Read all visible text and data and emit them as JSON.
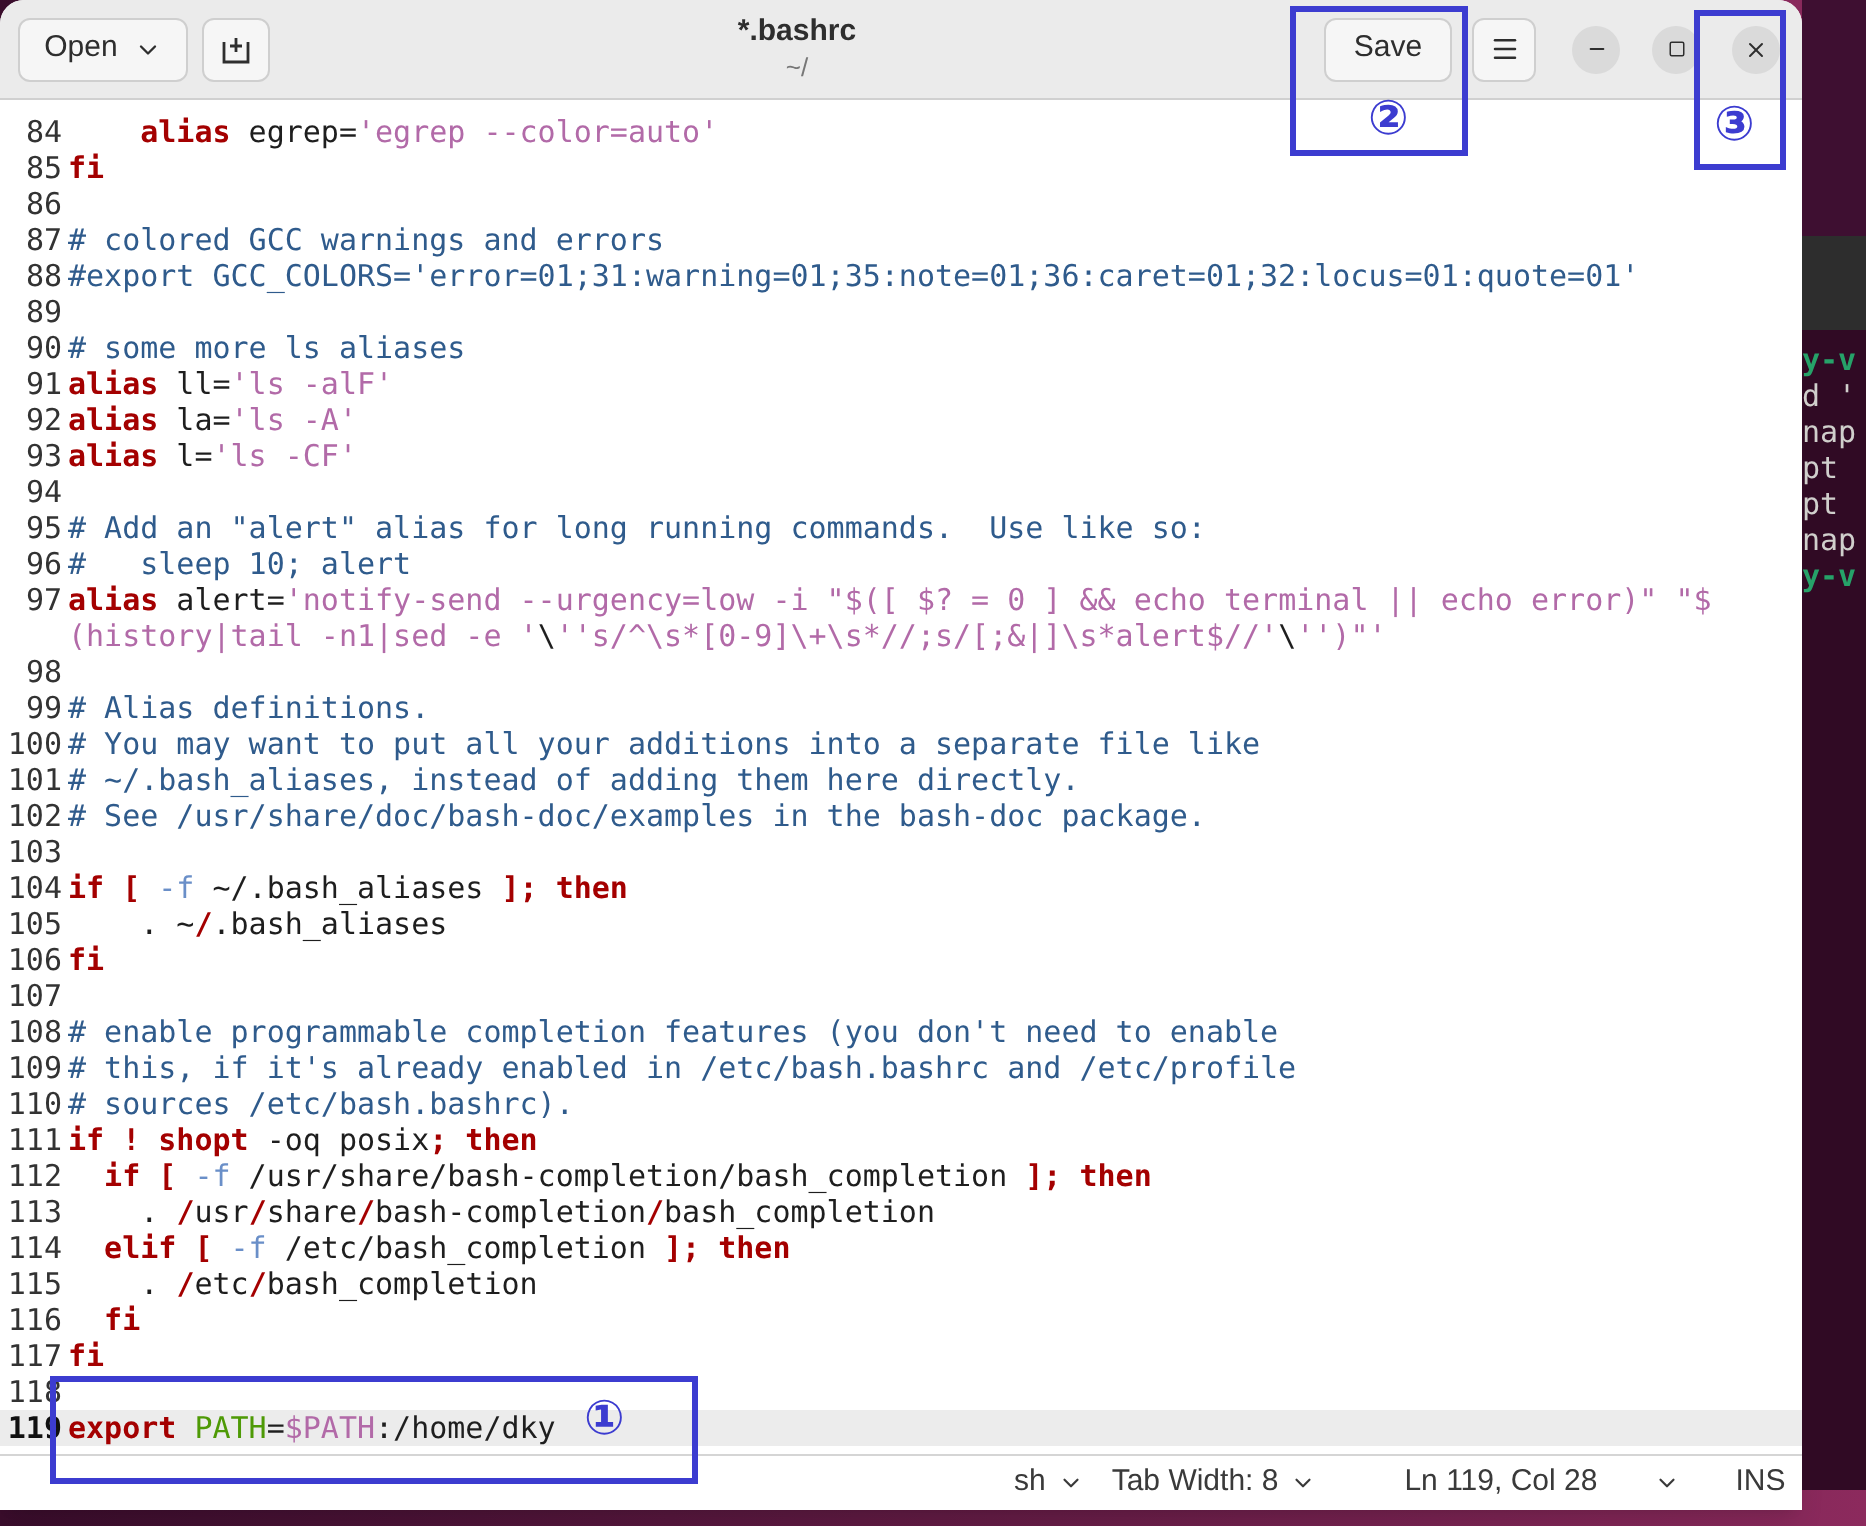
{
  "window": {
    "title": "*.bashrc",
    "subtitle": "~/"
  },
  "header": {
    "open_label": "Open",
    "save_label": "Save"
  },
  "editor": {
    "lines": [
      {
        "number": "84",
        "current": false,
        "tokens": [
          {
            "kind": "keyword",
            "text": "    alias"
          },
          {
            "kind": "plain",
            "text": " egrep="
          },
          {
            "kind": "string",
            "text": "'egrep --color=auto'"
          }
        ]
      },
      {
        "number": "85",
        "current": false,
        "tokens": [
          {
            "kind": "keyword",
            "text": "fi"
          }
        ]
      },
      {
        "number": "86",
        "current": false
      },
      {
        "number": "87",
        "current": false,
        "tokens": [
          {
            "kind": "comment",
            "text": "# colored GCC warnings and errors"
          }
        ]
      },
      {
        "number": "88",
        "current": false,
        "tokens": [
          {
            "kind": "comment",
            "text": "#export GCC_COLORS='error=01;31:warning=01;35:note=01;36:caret=01;32:locus=01:quote=01'"
          }
        ]
      },
      {
        "number": "89",
        "current": false
      },
      {
        "number": "90",
        "current": false,
        "tokens": [
          {
            "kind": "comment",
            "text": "# some more ls aliases"
          }
        ]
      },
      {
        "number": "91",
        "current": false,
        "tokens": [
          {
            "kind": "keyword",
            "text": "alias"
          },
          {
            "kind": "plain",
            "text": " ll="
          },
          {
            "kind": "string",
            "text": "'ls -alF'"
          }
        ]
      },
      {
        "number": "92",
        "current": false,
        "tokens": [
          {
            "kind": "keyword",
            "text": "alias"
          },
          {
            "kind": "plain",
            "text": " la="
          },
          {
            "kind": "string",
            "text": "'ls -A'"
          }
        ]
      },
      {
        "number": "93",
        "current": false,
        "tokens": [
          {
            "kind": "keyword",
            "text": "alias"
          },
          {
            "kind": "plain",
            "text": " l="
          },
          {
            "kind": "string",
            "text": "'ls -CF'"
          }
        ]
      },
      {
        "number": "94",
        "current": false
      },
      {
        "number": "95",
        "current": false,
        "tokens": [
          {
            "kind": "comment",
            "text": "# Add an \"alert\" alias for long running commands.  Use like so:"
          }
        ]
      },
      {
        "number": "96",
        "current": false,
        "tokens": [
          {
            "kind": "comment",
            "text": "#   sleep 10; alert"
          }
        ]
      },
      {
        "number": "97",
        "current": false,
        "tokens": [
          {
            "kind": "keyword",
            "text": "alias"
          },
          {
            "kind": "plain",
            "text": " alert="
          },
          {
            "kind": "string",
            "text": "'notify-send --urgency=low -i \"$([ $? = 0 ] && echo terminal || echo error)\" \"$"
          }
        ],
        "continuation": [
          {
            "kind": "string",
            "text": "(history|tail -n1|sed -e '"
          },
          {
            "kind": "plain",
            "text": "\\"
          },
          {
            "kind": "string",
            "text": "''s/^\\s*[0-9]\\+\\s*//;s/[;&|]\\s*alert$//'"
          },
          {
            "kind": "plain",
            "text": "\\"
          },
          {
            "kind": "string",
            "text": "'')\"'"
          }
        ]
      },
      {
        "number": "98",
        "current": false
      },
      {
        "number": "99",
        "current": false,
        "tokens": [
          {
            "kind": "comment",
            "text": "# Alias definitions."
          }
        ]
      },
      {
        "number": "100",
        "current": false,
        "tokens": [
          {
            "kind": "comment",
            "text": "# You may want to put all your additions into a separate file like"
          }
        ]
      },
      {
        "number": "101",
        "current": false,
        "tokens": [
          {
            "kind": "comment",
            "text": "# ~/.bash_aliases, instead of adding them here directly."
          }
        ]
      },
      {
        "number": "102",
        "current": false,
        "tokens": [
          {
            "kind": "comment",
            "text": "# See /usr/share/doc/bash-doc/examples in the bash-doc package."
          }
        ]
      },
      {
        "number": "103",
        "current": false
      },
      {
        "number": "104",
        "current": false,
        "tokens": [
          {
            "kind": "keyword",
            "text": "if ["
          },
          {
            "kind": "option",
            "text": " -f"
          },
          {
            "kind": "plain",
            "text": " ~/.bash_aliases "
          },
          {
            "kind": "keyword",
            "text": "]; then"
          }
        ]
      },
      {
        "number": "105",
        "current": false,
        "tokens": [
          {
            "kind": "plain",
            "text": "    . ~"
          },
          {
            "kind": "keyword",
            "text": "/"
          },
          {
            "kind": "plain",
            "text": ".bash_aliases"
          }
        ]
      },
      {
        "number": "106",
        "current": false,
        "tokens": [
          {
            "kind": "keyword",
            "text": "fi"
          }
        ]
      },
      {
        "number": "107",
        "current": false
      },
      {
        "number": "108",
        "current": false,
        "tokens": [
          {
            "kind": "comment",
            "text": "# enable programmable completion features (you don't need to enable"
          }
        ]
      },
      {
        "number": "109",
        "current": false,
        "tokens": [
          {
            "kind": "comment",
            "text": "# this, if it's already enabled in /etc/bash.bashrc and /etc/profile"
          }
        ]
      },
      {
        "number": "110",
        "current": false,
        "tokens": [
          {
            "kind": "comment",
            "text": "# sources /etc/bash.bashrc)."
          }
        ]
      },
      {
        "number": "111",
        "current": false,
        "tokens": [
          {
            "kind": "keyword",
            "text": "if ! shopt"
          },
          {
            "kind": "plain",
            "text": " -oq posix"
          },
          {
            "kind": "keyword",
            "text": "; then"
          }
        ]
      },
      {
        "number": "112",
        "current": false,
        "tokens": [
          {
            "kind": "keyword",
            "text": "  if ["
          },
          {
            "kind": "option",
            "text": " -f"
          },
          {
            "kind": "plain",
            "text": " /usr/share/bash-completion/bash_completion "
          },
          {
            "kind": "keyword",
            "text": "]; then"
          }
        ]
      },
      {
        "number": "113",
        "current": false,
        "tokens": [
          {
            "kind": "plain",
            "text": "    . "
          },
          {
            "kind": "keyword",
            "text": "/"
          },
          {
            "kind": "plain",
            "text": "usr"
          },
          {
            "kind": "keyword",
            "text": "/"
          },
          {
            "kind": "plain",
            "text": "share"
          },
          {
            "kind": "keyword",
            "text": "/"
          },
          {
            "kind": "plain",
            "text": "bash-completion"
          },
          {
            "kind": "keyword",
            "text": "/"
          },
          {
            "kind": "plain",
            "text": "bash_completion"
          }
        ]
      },
      {
        "number": "114",
        "current": false,
        "tokens": [
          {
            "kind": "keyword",
            "text": "  elif ["
          },
          {
            "kind": "option",
            "text": " -f"
          },
          {
            "kind": "plain",
            "text": " /etc/bash_completion "
          },
          {
            "kind": "keyword",
            "text": "]; then"
          }
        ]
      },
      {
        "number": "115",
        "current": false,
        "tokens": [
          {
            "kind": "plain",
            "text": "    . "
          },
          {
            "kind": "keyword",
            "text": "/"
          },
          {
            "kind": "plain",
            "text": "etc"
          },
          {
            "kind": "keyword",
            "text": "/"
          },
          {
            "kind": "plain",
            "text": "bash_completion"
          }
        ]
      },
      {
        "number": "116",
        "current": false,
        "tokens": [
          {
            "kind": "keyword",
            "text": "  fi"
          }
        ]
      },
      {
        "number": "117",
        "current": false,
        "tokens": [
          {
            "kind": "keyword",
            "text": "fi"
          }
        ]
      },
      {
        "number": "118",
        "current": false
      },
      {
        "number": "119",
        "current": true,
        "tokens": [
          {
            "kind": "keyword",
            "text": "export"
          },
          {
            "kind": "variable",
            "text": " PATH"
          },
          {
            "kind": "plain",
            "text": "="
          },
          {
            "kind": "string",
            "text": "$PATH"
          },
          {
            "kind": "plain",
            "text": ":/home/dky"
          }
        ]
      }
    ]
  },
  "status_bar": {
    "language": "sh",
    "tab_width": "Tab Width: 8",
    "position": "Ln 119, Col 28",
    "mode": "INS"
  },
  "annotations": [
    {
      "kind": "save",
      "label": "②"
    },
    {
      "kind": "close",
      "label": "③"
    },
    {
      "kind": "last_line",
      "label": "①"
    }
  ],
  "background_terminal": {
    "lines": [
      {
        "kind": "prompt",
        "text": "y-v"
      },
      {
        "kind": "output",
        "text": "d '"
      },
      {
        "kind": "output",
        "text": "nap"
      },
      {
        "kind": "output",
        "text": "pt"
      },
      {
        "kind": "output",
        "text": "pt"
      },
      {
        "kind": "output",
        "text": "nap"
      },
      {
        "kind": "prompt",
        "text": "y-v"
      }
    ]
  }
}
